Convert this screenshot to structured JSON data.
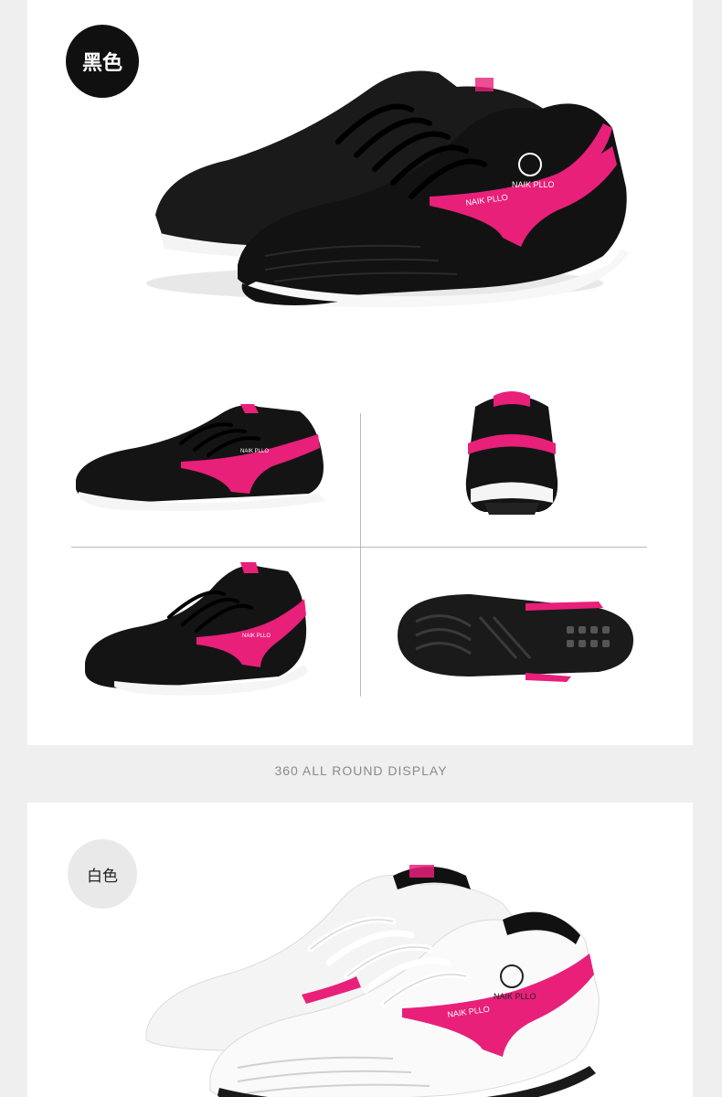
{
  "black_section": {
    "color_label": "黑色",
    "brand_text": "NAIK PLLO",
    "colors": {
      "upper": "#111111",
      "accent": "#e8207a",
      "sole": "#ffffff"
    }
  },
  "caption": "360 ALL ROUND DISPLAY",
  "white_section": {
    "color_label": "白色",
    "brand_text": "NAIK PLLO",
    "colors": {
      "upper": "#f7f7f7",
      "accent": "#e8207a",
      "collar": "#111111"
    }
  }
}
